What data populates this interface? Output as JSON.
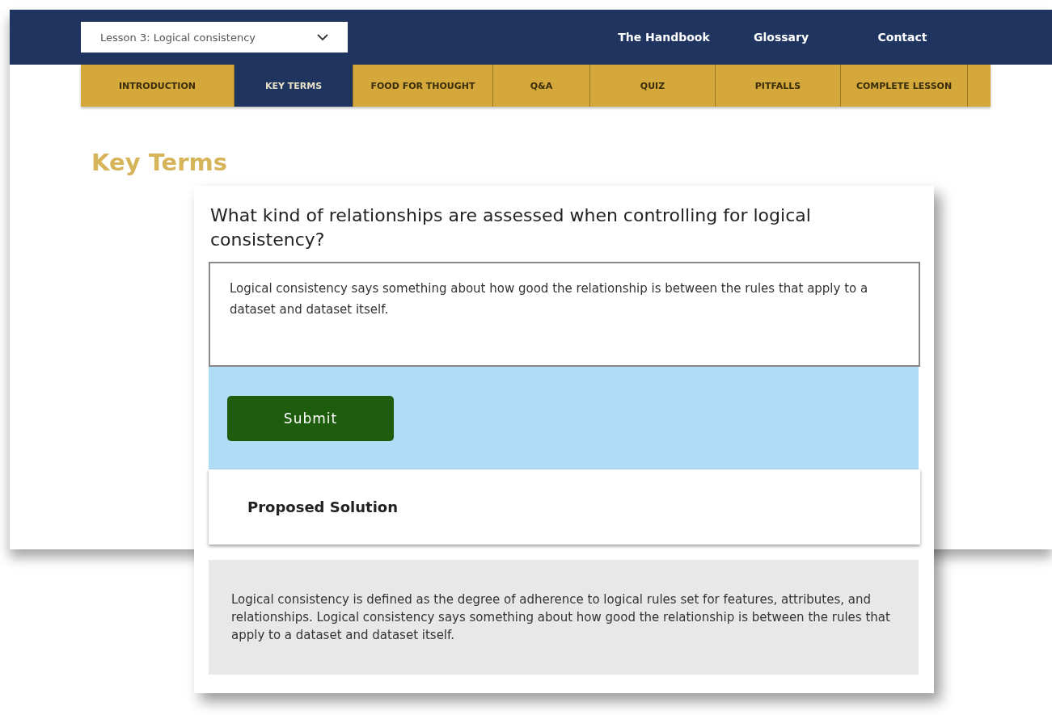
{
  "lesson_select": {
    "value": "Lesson 3: Logical consistency"
  },
  "top_links": [
    "The Handbook",
    "Glossary",
    "Contact"
  ],
  "tabs": [
    {
      "label": "INTRODUCTION",
      "selected": false
    },
    {
      "label": "KEY TERMS",
      "selected": true
    },
    {
      "label": "FOOD FOR THOUGHT",
      "selected": false
    },
    {
      "label": "Q&A",
      "selected": false
    },
    {
      "label": "QUIZ",
      "selected": false
    },
    {
      "label": "PITFALLS",
      "selected": false
    },
    {
      "label": "COMPLETE LESSON",
      "selected": false
    }
  ],
  "heading": "Key Terms",
  "question_card": {
    "question": "What kind of relationships are assessed when controlling for logical consistency?",
    "answer": "Logical consistency says something about how good the relationship is between the rules that apply to a dataset and dataset itself.",
    "submit": "Submit",
    "solution_title": "Proposed Solution",
    "solution_text": "Logical consistency is defined as the degree of adherence to logical rules set for features, attributes, and relationships. Logical consistency says something about how good the relationship is between the rules that apply to a dataset and dataset itself."
  }
}
